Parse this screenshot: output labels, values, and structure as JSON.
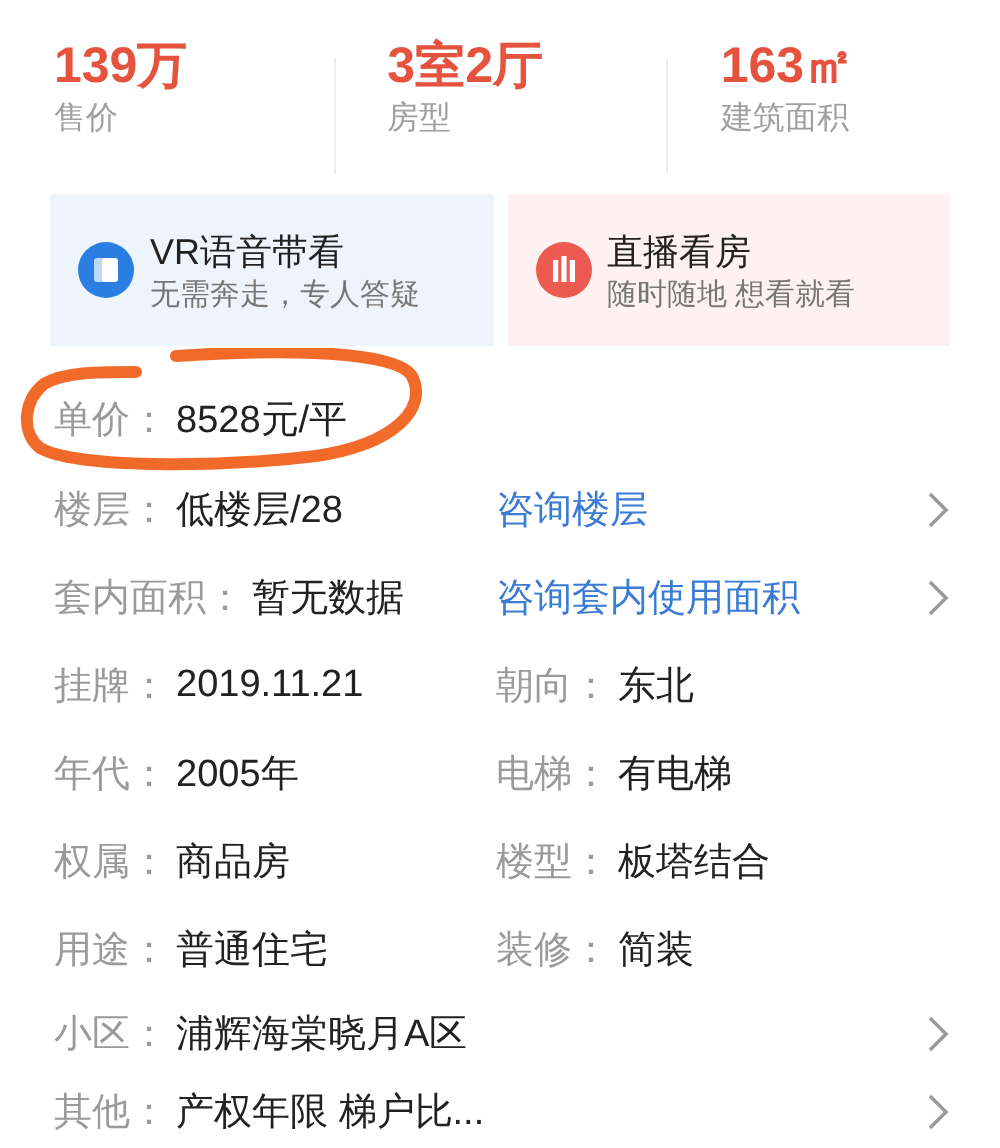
{
  "stats": [
    {
      "value": "139万",
      "label": "售价"
    },
    {
      "value": "3室2厅",
      "label": "房型"
    },
    {
      "value": "163㎡",
      "label": "建筑面积"
    }
  ],
  "features": [
    {
      "kind": "vr",
      "title": "VR语音带看",
      "subtitle": "无需奔走，专人答疑"
    },
    {
      "kind": "live",
      "title": "直播看房",
      "subtitle": "随时随地 想看就看"
    }
  ],
  "unit_price": {
    "label": "单价：",
    "value": "8528元/平",
    "highlighted": true
  },
  "rows": [
    {
      "kind": "link",
      "label": "楼层：",
      "value": "低楼层/28",
      "link": "咨询楼层"
    },
    {
      "kind": "link",
      "label": "套内面积：",
      "value": "暂无数据",
      "link": "咨询套内使用面积"
    },
    {
      "kind": "pair",
      "label": "挂牌：",
      "value": "2019.11.21",
      "label_2": "朝向：",
      "value_2": "东北"
    },
    {
      "kind": "pair",
      "label": "年代：",
      "value": "2005年",
      "label_2": "电梯：",
      "value_2": "有电梯"
    },
    {
      "kind": "pair",
      "label": "权属：",
      "value": "商品房",
      "label_2": "楼型：",
      "value_2": "板塔结合"
    },
    {
      "kind": "pair",
      "label": "用途：",
      "value": "普通住宅",
      "label_2": "装修：",
      "value_2": "简装"
    },
    {
      "kind": "nav",
      "label": "小区：",
      "value": "浦辉海棠晓月A区"
    },
    {
      "kind": "nav",
      "label": "其他：",
      "value": "产权年限 梯户比..."
    }
  ]
}
